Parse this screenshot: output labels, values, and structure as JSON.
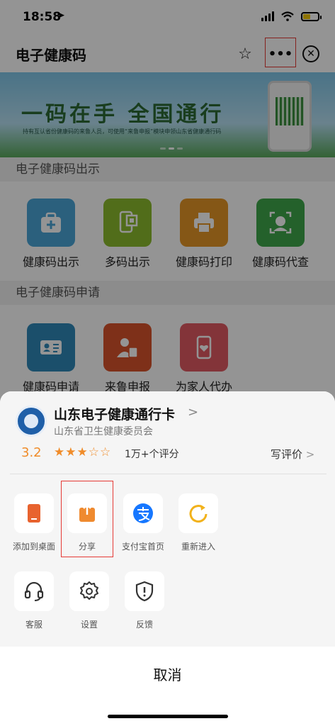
{
  "status": {
    "time": "18:58"
  },
  "nav": {
    "title": "电子健康码",
    "star_icon": "star-icon",
    "more_icon": "more-dots-icon",
    "close_icon": "close-circle-icon"
  },
  "banner": {
    "slogan": "一码在手 全国通行",
    "subtext": "持有互认省份健康码的来鲁人员，可使用“来鲁申报”模块申领山东省健康通行码",
    "active_dot": 2
  },
  "sections": [
    {
      "title": "电子健康码出示",
      "items": [
        {
          "label": "健康码出示",
          "color": "#4aa6d8"
        },
        {
          "label": "多码出示",
          "color": "#8cbc2e"
        },
        {
          "label": "健康码打印",
          "color": "#e59726"
        },
        {
          "label": "健康码代查",
          "color": "#3fa84a"
        }
      ]
    },
    {
      "title": "电子健康码申请",
      "items": [
        {
          "label": "健康码申请",
          "color": "#2f89b8"
        },
        {
          "label": "来鲁申报",
          "color": "#d9542b"
        },
        {
          "label": "为家人代办",
          "color": "#e25a62"
        }
      ]
    }
  ],
  "sheet": {
    "app_name": "山东电子健康通行卡",
    "org": "山东省卫生健康委员会",
    "rating": "3.2",
    "stars": "★★★☆☆",
    "rating_count": "1万+个评分",
    "write_review": "写评价",
    "actions": [
      {
        "label": "添加到桌面",
        "icon": "add-to-desktop-icon",
        "color": "#e8632f"
      },
      {
        "label": "分享",
        "icon": "share-icon",
        "color": "#ef8a2f"
      },
      {
        "label": "支付宝首页",
        "icon": "alipay-icon",
        "color": "#1677ff"
      },
      {
        "label": "重新进入",
        "icon": "refresh-icon",
        "color": "#f2b21b"
      },
      {
        "label": "客服",
        "icon": "headset-icon",
        "color": "#333333"
      },
      {
        "label": "设置",
        "icon": "gear-icon",
        "color": "#333333"
      },
      {
        "label": "反馈",
        "icon": "feedback-shield-icon",
        "color": "#333333"
      }
    ],
    "cancel": "取消"
  }
}
